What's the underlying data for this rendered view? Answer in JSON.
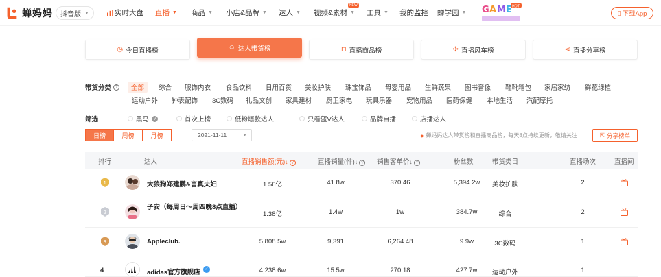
{
  "header": {
    "logo_text": "蝉妈妈",
    "edition": "抖音版",
    "nav": [
      {
        "label": "实时大盘",
        "icon": "bar-chart-icon",
        "active": false
      },
      {
        "label": "直播",
        "active": true
      },
      {
        "label": "商品"
      },
      {
        "label": "小店&品牌"
      },
      {
        "label": "达人"
      },
      {
        "label": "视频&素材",
        "badge": "NEW"
      },
      {
        "label": "工具"
      },
      {
        "label": "我的监控"
      },
      {
        "label": "蝉学园"
      }
    ],
    "game_badge": "HOT",
    "download": "下载App"
  },
  "tabs": [
    {
      "label": "今日直播榜",
      "icon": "clock-icon"
    },
    {
      "label": "达人带货榜",
      "icon": "smile-icon",
      "active": true
    },
    {
      "label": "直播商品榜",
      "icon": "bag-icon"
    },
    {
      "label": "直播风车榜",
      "icon": "windmill-icon"
    },
    {
      "label": "直播分享榜",
      "icon": "share-icon"
    }
  ],
  "categories": {
    "label": "带货分类",
    "items": [
      "全部",
      "综合",
      "服饰内衣",
      "食品饮料",
      "日用百货",
      "美妆护肤",
      "珠宝饰品",
      "母婴用品",
      "生鲜蔬果",
      "图书音像",
      "鞋靴箱包",
      "家居家纺",
      "鲜花绿植",
      "运动户外",
      "钟表配饰",
      "3C数码",
      "礼品文创",
      "家具建材",
      "厨卫家电",
      "玩具乐器",
      "宠物用品",
      "医药保健",
      "本地生活",
      "汽配摩托"
    ]
  },
  "filters": {
    "label": "筛选",
    "items": [
      "黑马",
      "首次上榜",
      "低粉爆款达人",
      "只看蓝V达人",
      "品牌自播",
      "店播达人"
    ]
  },
  "period": {
    "options": [
      "日榜",
      "周榜",
      "月榜"
    ],
    "date": "2021-11-11"
  },
  "notice": "蝉妈妈达人带货榜和直播商品榜，每天8点持续更新，敬请关注",
  "share_button": "分享榜单",
  "table": {
    "headers": [
      "排行",
      "达人",
      "直播销售额(元)",
      "直播销量(件)",
      "销售客单价",
      "粉丝数",
      "带货类目",
      "直播场次",
      "直播间"
    ],
    "rows": [
      {
        "rank": "1",
        "name": "大狼狗郑建鹏&言真夫妇",
        "sales": "1.56亿",
        "volume": "41.8w",
        "price": "370.46",
        "fans": "5,394.2w",
        "category": "美妆护肤",
        "sessions": "2"
      },
      {
        "rank": "2",
        "name": "子安（每周日～周四晚8点直播）",
        "sales": "1.38亿",
        "volume": "1.4w",
        "price": "1w",
        "fans": "384.7w",
        "category": "综合",
        "sessions": "2"
      },
      {
        "rank": "3",
        "name": "Appleclub.",
        "sales": "5,808.5w",
        "volume": "9,391",
        "price": "6,264.48",
        "fans": "9.9w",
        "category": "3C数码",
        "sessions": "1"
      },
      {
        "rank": "4",
        "name": "adidas官方旗舰店",
        "sales": "4,238.6w",
        "volume": "15.5w",
        "price": "270.18",
        "fans": "427.7w",
        "category": "运动户外",
        "sessions": "1"
      }
    ]
  },
  "colors": {
    "accent": "#f5612d",
    "accent_light": "#f5764a",
    "header_bg": "#f5f6f8"
  }
}
